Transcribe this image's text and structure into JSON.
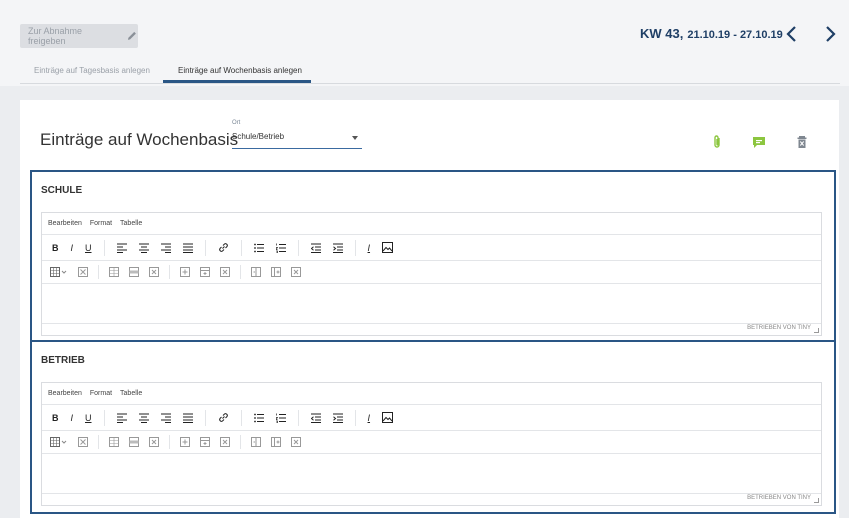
{
  "header": {
    "approve_label": "Zur Abnahme freigeben",
    "tabs": [
      "Einträge auf Tagesbasis anlegen",
      "Einträge auf Wochenbasis anlegen"
    ],
    "week_prefix": "KW 43,",
    "week_range": "21.10.19 - 27.10.19",
    "accent": "#2a5685"
  },
  "card": {
    "title": "Einträge auf Wochenbasis",
    "ort_label": "Ort",
    "ort_value": "Schule/Betrieb",
    "icons": [
      "paperclip-icon",
      "comment-icon",
      "trash-icon"
    ],
    "icon_color": "#8cc63f"
  },
  "sections": [
    {
      "title": "SCHULE",
      "menu": [
        "Bearbeiten",
        "Format",
        "Tabelle"
      ],
      "powered_by": "BETRIEBEN VON TINY"
    },
    {
      "title": "BETRIEB",
      "menu": [
        "Bearbeiten",
        "Format",
        "Tabelle"
      ],
      "powered_by": "BETRIEBEN VON TINY"
    }
  ],
  "toolbar": {
    "bold": "B",
    "italic": "I",
    "underline": "U",
    "clear_format": "I"
  }
}
